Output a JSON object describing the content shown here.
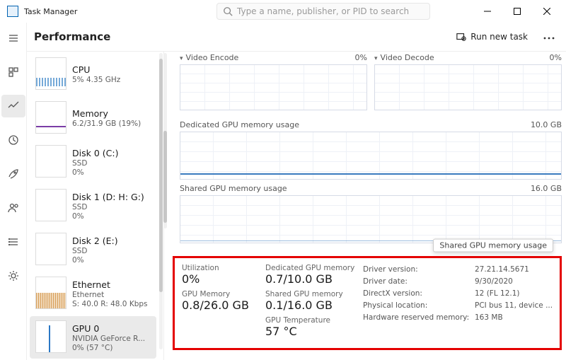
{
  "app": {
    "title": "Task Manager"
  },
  "search": {
    "placeholder": "Type a name, publisher, or PID to search"
  },
  "header": {
    "section": "Performance",
    "run_new_task": "Run new task"
  },
  "sidebar": {
    "items": [
      {
        "name": "CPU",
        "sub1": "5% 4.35 GHz"
      },
      {
        "name": "Memory",
        "sub1": "6.2/31.9 GB (19%)"
      },
      {
        "name": "Disk 0 (C:)",
        "sub1": "SSD",
        "sub2": "0%"
      },
      {
        "name": "Disk 1 (D: H: G:)",
        "sub1": "SSD",
        "sub2": "0%"
      },
      {
        "name": "Disk 2 (E:)",
        "sub1": "SSD",
        "sub2": "0%"
      },
      {
        "name": "Ethernet",
        "sub1": "Ethernet",
        "sub2": "S: 40.0 R: 48.0 Kbps"
      },
      {
        "name": "GPU 0",
        "sub1": "NVIDIA GeForce R...",
        "sub2": "0% (57 °C)"
      }
    ]
  },
  "detail": {
    "mini1": {
      "title": "Video Encode",
      "value": "0%"
    },
    "mini2": {
      "title": "Video Decode",
      "value": "0%"
    },
    "sec1": {
      "title": "Dedicated GPU memory usage",
      "max": "10.0 GB"
    },
    "sec2": {
      "title": "Shared GPU memory usage",
      "max": "16.0 GB",
      "tooltip": "Shared GPU memory usage"
    },
    "stats": {
      "utilization_label": "Utilization",
      "utilization": "0%",
      "gpu_memory_label": "GPU Memory",
      "gpu_memory": "0.8/26.0 GB",
      "dedicated_label": "Dedicated GPU memory",
      "dedicated": "0.7/10.0 GB",
      "shared_label": "Shared GPU memory",
      "shared": "0.1/16.0 GB",
      "temperature_label": "GPU Temperature",
      "temperature": "57 °C",
      "driver_version_label": "Driver version:",
      "driver_version": "27.21.14.5671",
      "driver_date_label": "Driver date:",
      "driver_date": "9/30/2020",
      "directx_label": "DirectX version:",
      "directx": "12 (FL 12.1)",
      "location_label": "Physical location:",
      "location": "PCI bus 11, device ...",
      "reserved_label": "Hardware reserved memory:",
      "reserved": "163 MB"
    }
  }
}
